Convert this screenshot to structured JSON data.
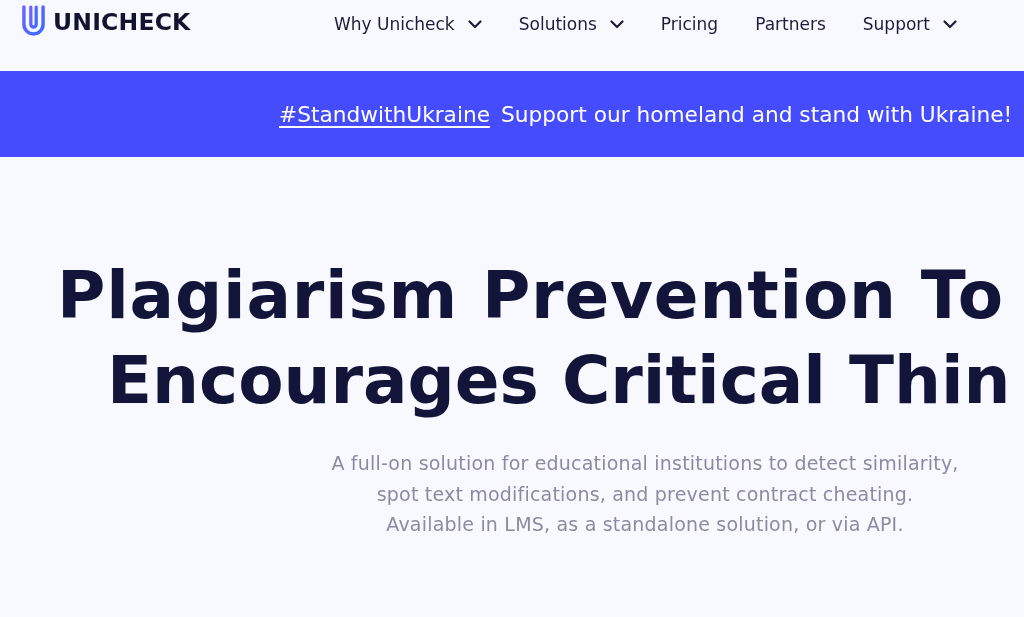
{
  "header": {
    "logo": {
      "text": "UNICHECK"
    },
    "nav": [
      {
        "label": "Why Unicheck",
        "dropdown": true
      },
      {
        "label": "Solutions",
        "dropdown": true
      },
      {
        "label": "Pricing",
        "dropdown": false
      },
      {
        "label": "Partners",
        "dropdown": false
      },
      {
        "label": "Support",
        "dropdown": true
      }
    ]
  },
  "banner": {
    "link": "#StandwithUkraine",
    "message": "Support our homeland and stand with Ukraine!"
  },
  "hero": {
    "title_lines": [
      "Plagiarism Prevention To",
      "Encourages Critical Thin"
    ],
    "subtitle_lines": [
      "A full-on solution for educational institutions to detect similarity,",
      "spot text modifications, and prevent contract cheating.",
      "Available in LMS, as a standalone solution, or via API."
    ]
  }
}
